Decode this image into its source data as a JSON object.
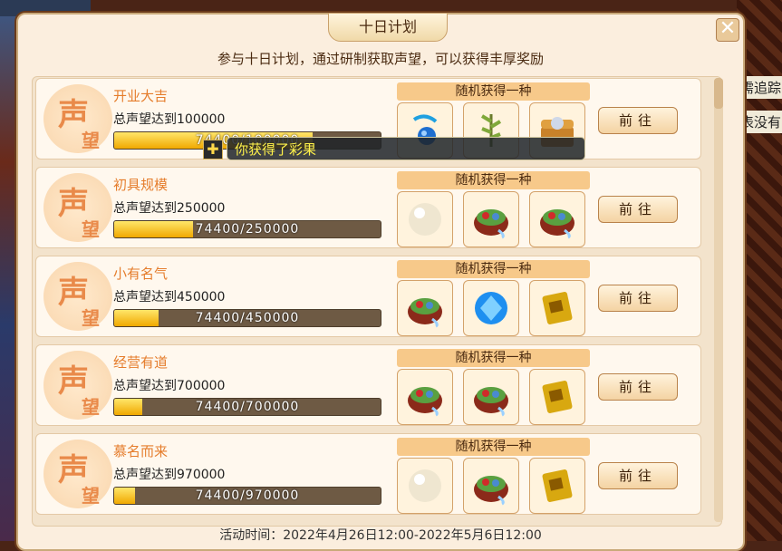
{
  "dialog": {
    "title": "十日计划",
    "close_label": "✕",
    "subtitle": "参与十日计划，通过研制获取声望，可以获得丰厚奖励",
    "footer": "活动时间：2022年4月26日12:00-2022年5月6日12:00",
    "emblem_top": "声",
    "emblem_bottom": "望",
    "rewards_label": "随机获得一种",
    "go_label": "前往"
  },
  "tasks": [
    {
      "title": "开业大吉",
      "requirement": "总声望达到100000",
      "progress_text": "74400/100000",
      "progress": 0.744,
      "rewards": [
        "blue-bell-ornament-icon",
        "herb-branch-icon",
        "treasure-chest-icon"
      ]
    },
    {
      "title": "初具规模",
      "requirement": "总声望达到250000",
      "progress_text": "74400/250000",
      "progress": 0.2976,
      "rewards": [
        "pearl-icon",
        "food-box-icon",
        "food-box-icon"
      ]
    },
    {
      "title": "小有名气",
      "requirement": "总声望达到450000",
      "progress_text": "74400/450000",
      "progress": 0.1653,
      "rewards": [
        "food-box-icon",
        "blue-gem-icon",
        "gold-book-icon"
      ]
    },
    {
      "title": "经营有道",
      "requirement": "总声望达到700000",
      "progress_text": "74400/700000",
      "progress": 0.1063,
      "rewards": [
        "food-box-icon",
        "food-box-icon",
        "gold-book-icon"
      ]
    },
    {
      "title": "慕名而来",
      "requirement": "总声望达到970000",
      "progress_text": "74400/970000",
      "progress": 0.0767,
      "rewards": [
        "pearl-icon",
        "food-box-icon",
        "gold-book-icon"
      ]
    }
  ],
  "toast": {
    "text": "你获得了彩果"
  },
  "background": {
    "right_text_1": "需追踪",
    "right_text_2": "表没有"
  },
  "colors": {
    "accent": "#e57d2c",
    "panel": "#fbeede",
    "toast_text": "#fff24a"
  }
}
